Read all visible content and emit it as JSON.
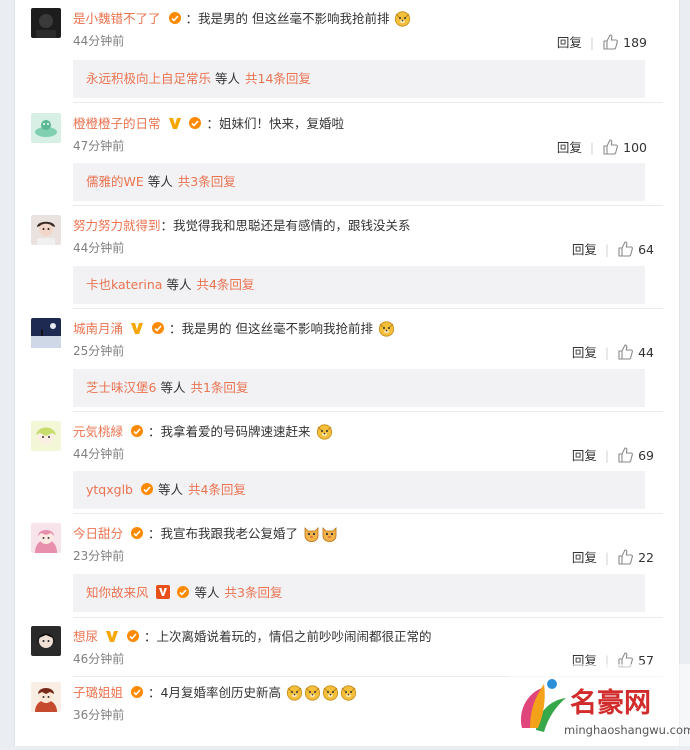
{
  "comments": [
    {
      "user": "是小魏错不了了",
      "badges": [
        "orange-vip-badge"
      ],
      "text": "我是男的  但这丝毫不影响我抢前排",
      "emojis": [
        "doge-emoji"
      ],
      "time": "44分钟前",
      "reply_label": "回复",
      "likes": "189",
      "replies": {
        "names": [
          "永远积极向上自足常乐"
        ],
        "suffix": "等人",
        "count": "共14条回复"
      }
    },
    {
      "user": "橙橙橙子的日常",
      "badges": [
        "gold-v-badge",
        "orange-vip-badge"
      ],
      "text": "姐妹们！快来，复婚啦",
      "emojis": [],
      "time": "47分钟前",
      "reply_label": "回复",
      "likes": "100",
      "replies": {
        "names": [
          "儒雅的WE"
        ],
        "suffix": "等人",
        "count": "共3条回复"
      }
    },
    {
      "user": "努力努力就得到",
      "badges": [],
      "text": "我觉得我和思聪还是有感情的，跟钱没关系",
      "emojis": [],
      "time": "44分钟前",
      "reply_label": "回复",
      "likes": "64",
      "replies": {
        "names": [
          "卡也katerina"
        ],
        "suffix": "等人",
        "count": "共4条回复"
      }
    },
    {
      "user": "城南月涌",
      "badges": [
        "gold-v-badge",
        "orange-vip-badge"
      ],
      "text": "我是男的  但这丝毫不影响我抢前排",
      "emojis": [
        "doge-emoji"
      ],
      "time": "25分钟前",
      "reply_label": "回复",
      "likes": "44",
      "replies": {
        "names": [
          "芝士味汉堡6"
        ],
        "suffix": "等人",
        "count": "共1条回复"
      }
    },
    {
      "user": "元気桃緑",
      "badges": [
        "orange-vip-badge"
      ],
      "text": "我拿着爱的号码牌速速赶来",
      "emojis": [
        "doge-emoji"
      ],
      "time": "44分钟前",
      "reply_label": "回复",
      "likes": "69",
      "replies": {
        "names": [
          "ytqxglb"
        ],
        "suffix": "等人",
        "count": "共4条回复"
      }
    },
    {
      "user": "今日甜分",
      "badges": [
        "orange-vip-badge"
      ],
      "text": "我宣布我跟我老公复婚了",
      "emojis": [
        "cat-emoji",
        "cat-emoji"
      ],
      "time": "23分钟前",
      "reply_label": "回复",
      "likes": "22",
      "replies": {
        "names": [
          "知你故来风"
        ],
        "suffix": "等人",
        "count": "共3条回复"
      }
    },
    {
      "user": "想尿",
      "badges": [
        "gold-v-badge",
        "orange-vip-badge"
      ],
      "text": "上次离婚说着玩的，情侣之前吵吵闹闹都很正常的",
      "emojis": [],
      "time": "46分钟前",
      "reply_label": "回复",
      "likes": "57",
      "replies": null
    },
    {
      "user": "子璐姐姐",
      "badges": [
        "orange-vip-badge"
      ],
      "text": "4月复婚率创历史新高",
      "emojis": [
        "doge-emoji",
        "doge-emoji",
        "doge-emoji",
        "doge-emoji"
      ],
      "time": "36分钟前",
      "reply_label": "",
      "likes": "",
      "replies": null
    }
  ],
  "watermark": {
    "title": "名豪网",
    "url": "minghaoshangwu.com"
  },
  "colors": {
    "username": "#eb7350",
    "reply_bg": "#f2f2f5",
    "time": "#808080"
  }
}
